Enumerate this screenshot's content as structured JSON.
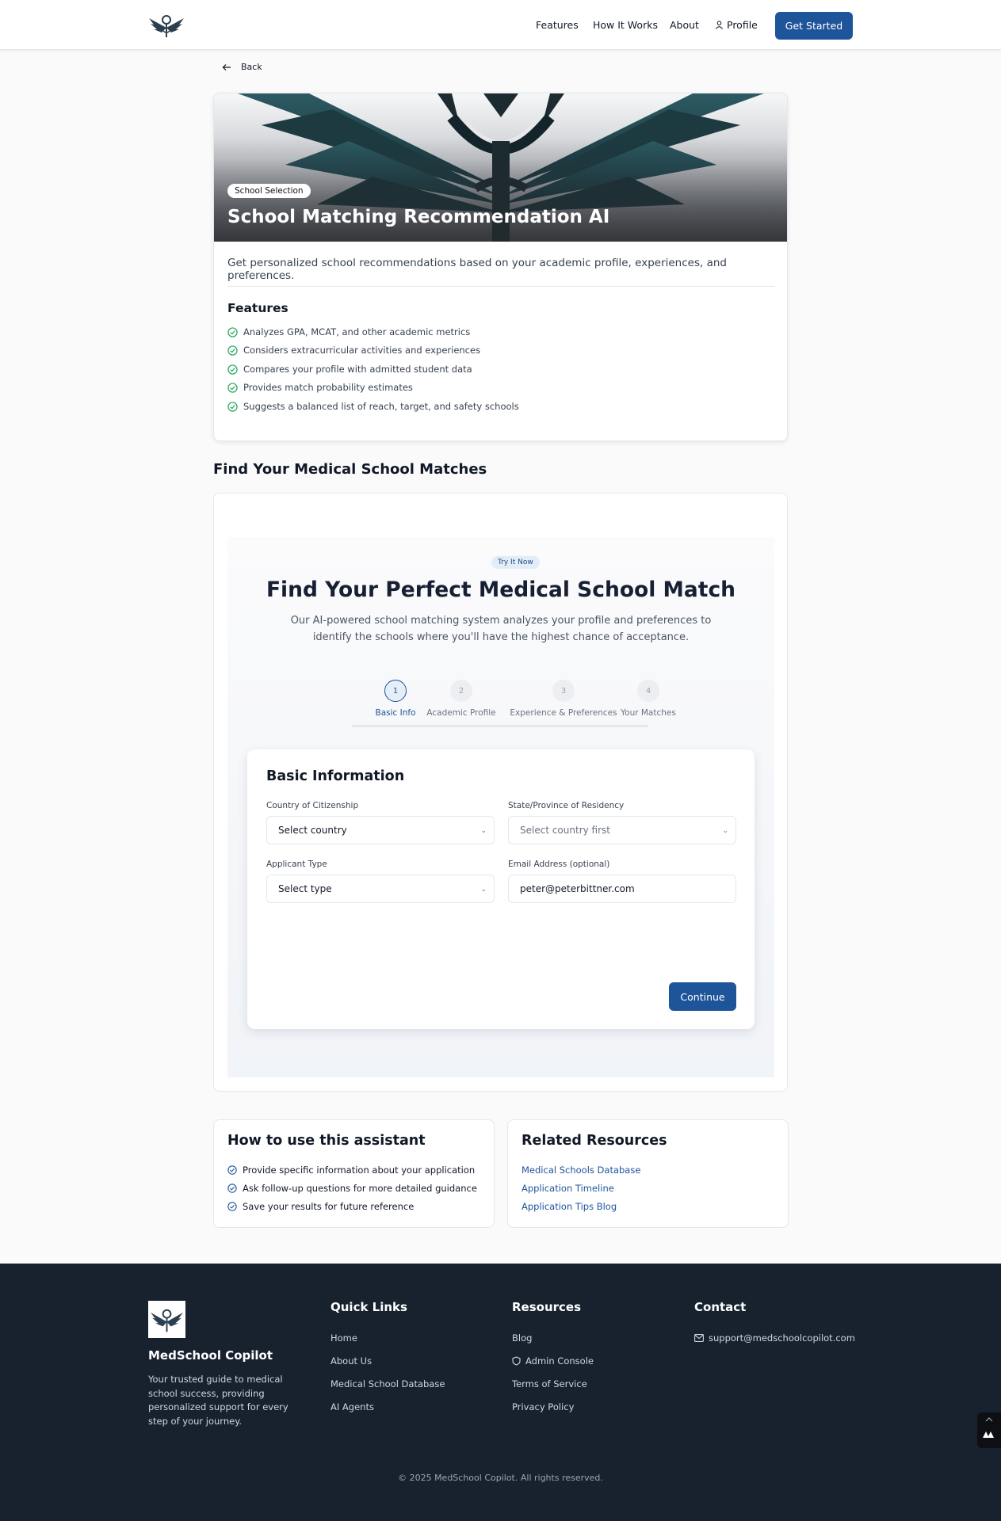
{
  "nav": {
    "features": "Features",
    "how_it_works": "How It Works",
    "about": "About",
    "profile": "Profile",
    "get_started": "Get Started"
  },
  "back_label": "Back",
  "hero": {
    "badge": "School Selection",
    "title": "School Matching Recommendation AI",
    "description": "Get personalized school recommendations based on your academic profile, experiences, and preferences.",
    "features_title": "Features",
    "features": [
      "Analyzes GPA, MCAT, and other academic metrics",
      "Considers extracurricular activities and experiences",
      "Compares your profile with admitted student data",
      "Provides match probability estimates",
      "Suggests a balanced list of reach, target, and safety schools"
    ]
  },
  "section_title": "Find Your Medical School Matches",
  "matcher": {
    "badge": "Try It Now",
    "title": "Find Your Perfect Medical School Match",
    "description": "Our AI-powered school matching system analyzes your profile and preferences to identify the schools where you'll have the highest chance of acceptance.",
    "steps": [
      {
        "num": "1",
        "label": "Basic Info"
      },
      {
        "num": "2",
        "label": "Academic Profile"
      },
      {
        "num": "3",
        "label": "Experience & Preferences"
      },
      {
        "num": "4",
        "label": "Your Matches"
      }
    ],
    "form": {
      "title": "Basic Information",
      "country_label": "Country of Citizenship",
      "country_value": "Select country",
      "state_label": "State/Province of Residency",
      "state_value": "Select country first",
      "type_label": "Applicant Type",
      "type_value": "Select type",
      "email_label": "Email Address (optional)",
      "email_value": "peter@peterbittner.com",
      "continue": "Continue"
    }
  },
  "how_to": {
    "title": "How to use this assistant",
    "items": [
      "Provide specific information about your application",
      "Ask follow-up questions for more detailed guidance",
      "Save your results for future reference"
    ]
  },
  "related": {
    "title": "Related Resources",
    "links": [
      "Medical Schools Database",
      "Application Timeline",
      "Application Tips Blog"
    ]
  },
  "footer": {
    "brand": "MedSchool Copilot",
    "tagline": "Your trusted guide to medical school success, providing personalized support for every step of your journey.",
    "quick_links_title": "Quick Links",
    "quick_links": [
      "Home",
      "About Us",
      "Medical School Database",
      "AI Agents"
    ],
    "resources_title": "Resources",
    "resources": [
      "Blog",
      "Admin Console",
      "Terms of Service",
      "Privacy Policy"
    ],
    "contact_title": "Contact",
    "email": "support@medschoolcopilot.com",
    "copyright": "© 2025 MedSchool Copilot. All rights reserved."
  },
  "colors": {
    "primary": "#1e5499",
    "check_green": "#22a55a",
    "footer_bg": "#18222f"
  },
  "icons": [
    "logo-wings-icon",
    "user-icon",
    "arrow-left-icon",
    "check-circle-icon",
    "chevron-down-icon",
    "shield-icon",
    "mail-icon"
  ]
}
